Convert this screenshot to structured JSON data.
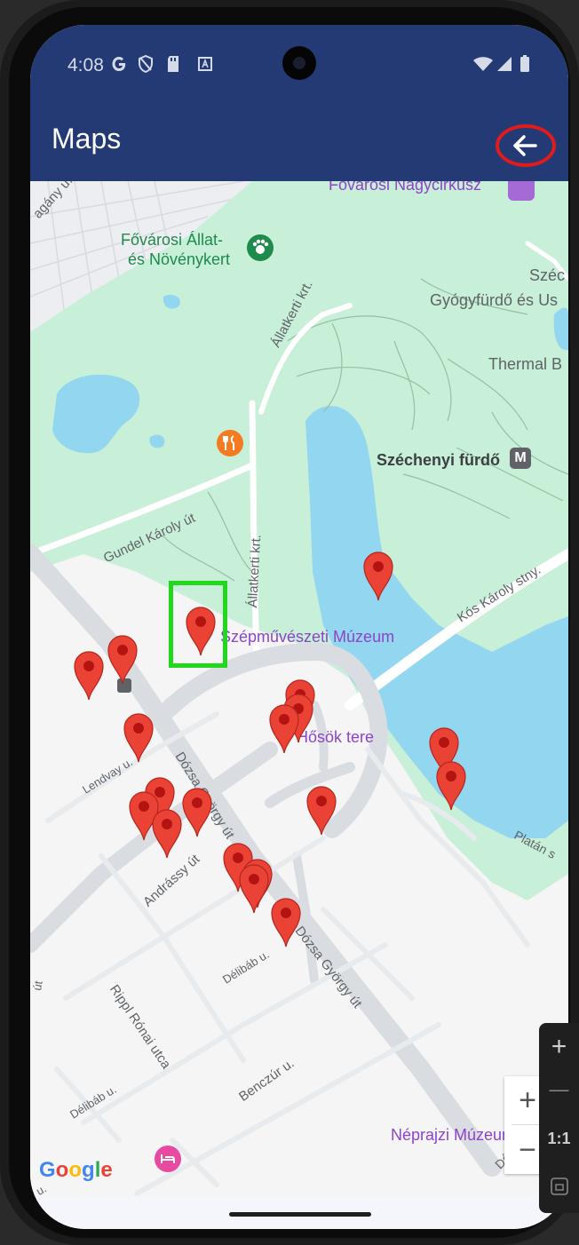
{
  "status_bar": {
    "time": "4:08"
  },
  "app_bar": {
    "title": "Maps",
    "back_icon": "arrow-left-icon"
  },
  "map": {
    "labels": {
      "circus": "Fővárosi Nagycirkusz",
      "zoo_line1": "Fővárosi Állat-",
      "zoo_line2": "és Növénykert",
      "spa_partial1": "Széc",
      "spa_partial2": "Gyógyfürdő és Us",
      "thermal": "Thermal B",
      "szechenyi_furdo": "Széchenyi fürdő",
      "metro_badge": "M",
      "allatkerti_top": "Állatkerti krt.",
      "allatkerti_side": "Állatkerti krt.",
      "gundel": "Gundel Károly út",
      "kos_karoly": "Kós Károly stny.",
      "museum_fine_arts": "Szépművészeti Múzeum",
      "heroes_square": "Hősök tere",
      "lendvay": "Lendvay u.",
      "dozsa": "Dózsa György út",
      "dozsa_lower": "Dózsa György út",
      "andrassy": "Andrássy út",
      "delibab1": "Délibáb u.",
      "delibab2": "Délibáb u.",
      "rippl": "Rippl Rónai utca",
      "benczur": "Benczúr u.",
      "platan": "Platán s",
      "ethnography": "Néprajzi Múzeum",
      "top_left_partial": "agány u.",
      "left_partial1": "út",
      "left_partial2": "u.",
      "bottom_right_partial": "Dóz"
    },
    "google_logo": [
      "G",
      "o",
      "o",
      "g",
      "l",
      "e"
    ],
    "google_colors": [
      "#4285F4",
      "#EA4335",
      "#FBBC05",
      "#4285F4",
      "#34A853",
      "#EA4335"
    ],
    "zoom_in": "+",
    "zoom_out": "−"
  },
  "emulator_tools": {
    "plus": "+",
    "minus": "—",
    "ratio": "1:1"
  },
  "colors": {
    "app_bar": "#243a75",
    "marker": "#EA4335",
    "park": "#c8efd8",
    "water": "#92d6ef",
    "selection": "#22d81c",
    "back_highlight": "#e01b1b"
  }
}
